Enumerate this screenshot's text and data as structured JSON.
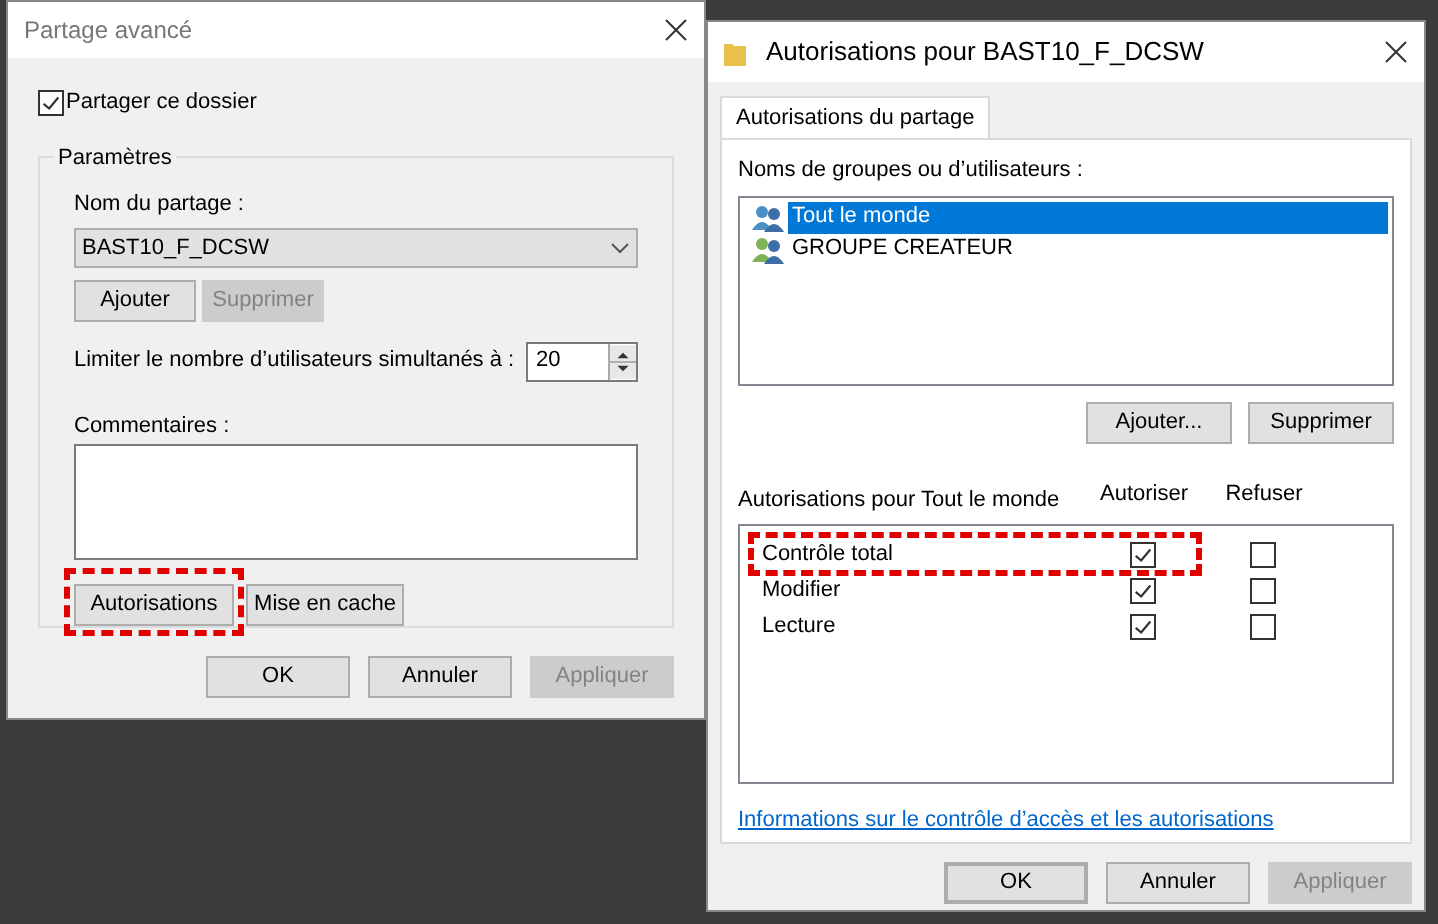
{
  "advanced_sharing": {
    "title": "Partage avancé",
    "share_checkbox": {
      "label": "Partager ce dossier",
      "checked": true
    },
    "settings_group": {
      "legend": "Paramètres",
      "share_name_label": "Nom du partage :",
      "share_name": "BAST10_F_DCSW",
      "buttons": [
        {
          "label": "Ajouter",
          "disabled": false
        },
        {
          "label": "Supprimer",
          "disabled": true
        }
      ],
      "limit_label": "Limiter le nombre d’utilisateurs simultanés à :",
      "limit_value": "20",
      "comments_label": "Commentaires :",
      "bottom_buttons": [
        {
          "label": "Autorisations",
          "highlighted": true
        },
        {
          "label": "Mise en cache",
          "highlighted": false
        }
      ]
    },
    "dialog_buttons": [
      {
        "label": "OK",
        "disabled": false
      },
      {
        "label": "Annuler",
        "disabled": false
      },
      {
        "label": "Appliquer",
        "disabled": true
      }
    ]
  },
  "permissions_dialog": {
    "title": "Autorisations pour BAST10_F_DCSW",
    "tabs": [
      {
        "label": "Autorisations du partage",
        "selected": true
      }
    ],
    "users_label": "Noms de groupes ou d’utilisateurs :",
    "users": [
      {
        "name": "Tout le monde",
        "selected": true
      },
      {
        "name": "GROUPE CREATEUR",
        "selected": false
      }
    ],
    "user_buttons": [
      "Ajouter...",
      "Supprimer"
    ],
    "permissions_label": "Autorisations pour Tout le monde",
    "columns": [
      "Autoriser",
      "Refuser"
    ],
    "permissions": [
      {
        "name": "Contrôle total",
        "allow": true,
        "deny": false,
        "highlighted": true
      },
      {
        "name": "Modifier",
        "allow": true,
        "deny": false,
        "highlighted": false
      },
      {
        "name": "Lecture",
        "allow": true,
        "deny": false,
        "highlighted": false
      }
    ],
    "link": "Informations sur le contrôle d’accès et les autorisations",
    "dialog_buttons": [
      {
        "label": "OK",
        "disabled": false,
        "default": true
      },
      {
        "label": "Annuler",
        "disabled": false,
        "default": false
      },
      {
        "label": "Appliquer",
        "disabled": true,
        "default": false
      }
    ]
  }
}
